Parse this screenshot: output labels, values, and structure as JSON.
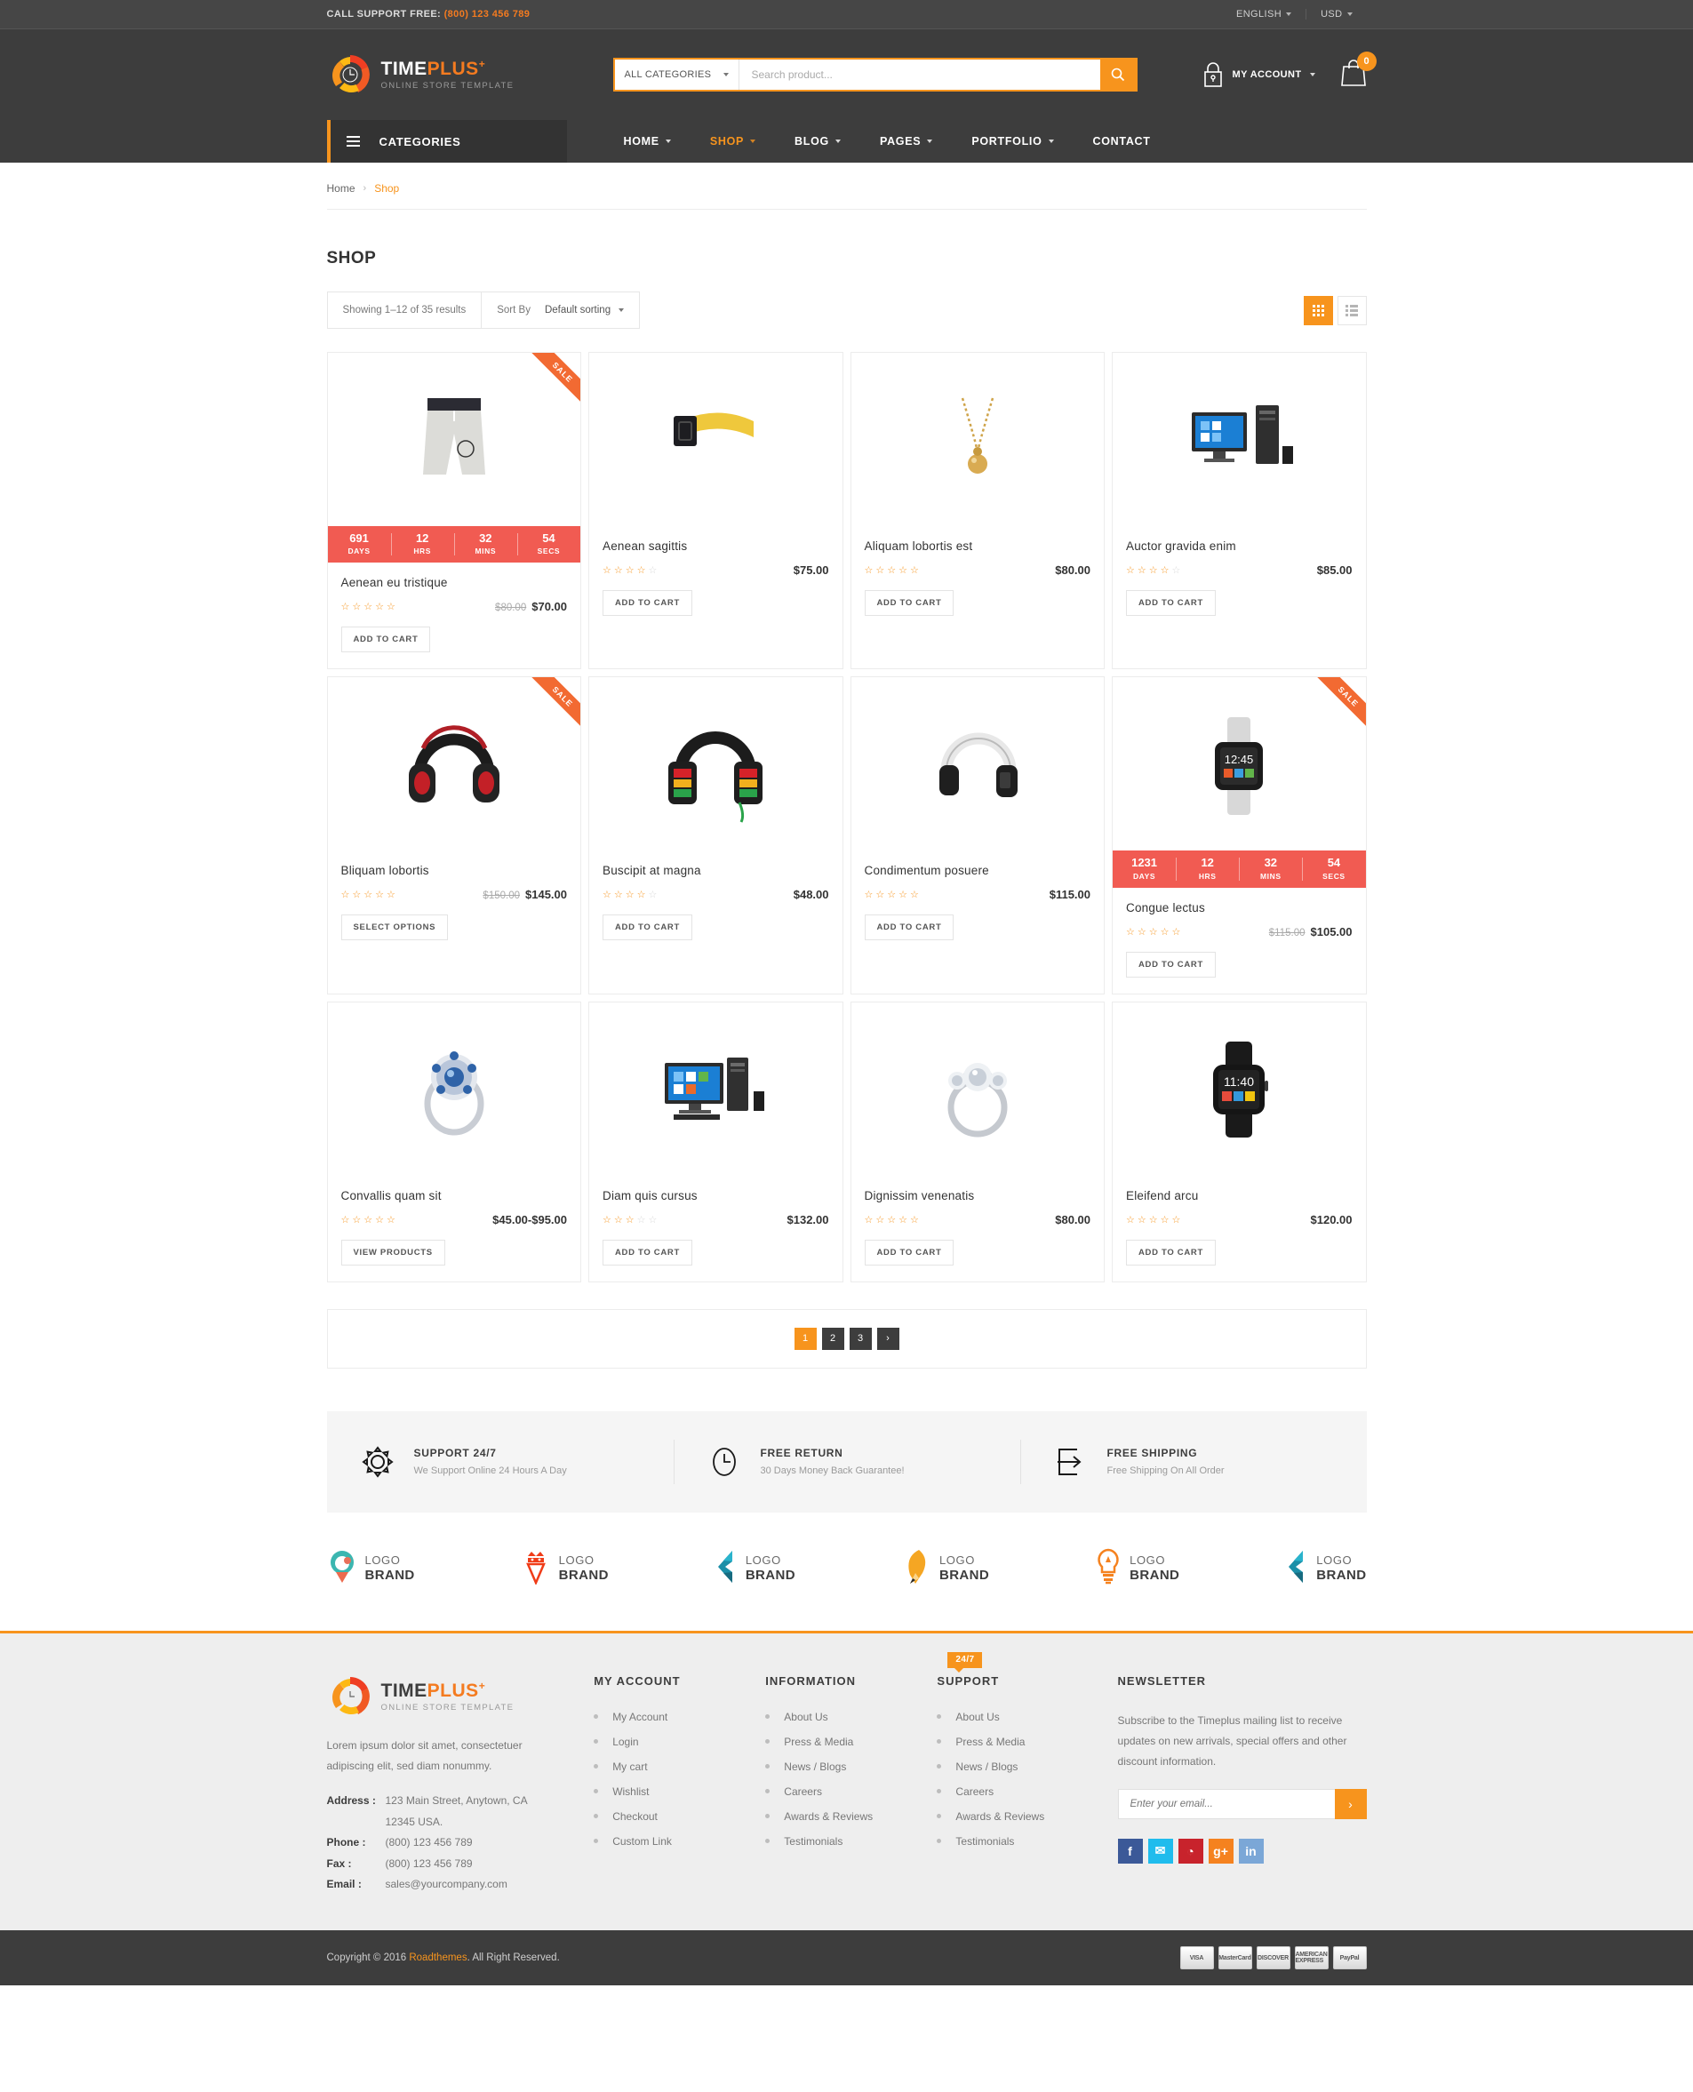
{
  "topbar": {
    "call_label": "CALL SUPPORT FREE:",
    "call_number": "(800) 123 456  789",
    "language": "ENGLISH",
    "currency": "USD"
  },
  "header": {
    "logo_name": "TIME",
    "logo_name2": "PLUS",
    "logo_sup": "+",
    "logo_tagline": "ONLINE STORE TEMPLATE",
    "category_select": "ALL CATEGORIES",
    "search_placeholder": "Search product...",
    "search_value": "",
    "search_icon": "search-icon",
    "account_label": "MY ACCOUNT",
    "account_icon": "lock-icon",
    "cart_icon": "shopping-bag-icon",
    "cart_count": "0"
  },
  "nav": {
    "categories_label": "CATEGORIES",
    "menu_icon": "hamburger-icon",
    "items": [
      {
        "label": "HOME",
        "has_caret": true,
        "active": false
      },
      {
        "label": "SHOP",
        "has_caret": true,
        "active": true
      },
      {
        "label": "BLOG",
        "has_caret": true,
        "active": false
      },
      {
        "label": "PAGES",
        "has_caret": true,
        "active": false
      },
      {
        "label": "PORTFOLIO",
        "has_caret": true,
        "active": false
      },
      {
        "label": "CONTACT",
        "has_caret": false,
        "active": false
      }
    ]
  },
  "breadcrumb": {
    "home": "Home",
    "separator": "›",
    "current": "Shop"
  },
  "page": {
    "title": "SHOP"
  },
  "toolbar": {
    "results_text": "Showing 1–12 of 35 results",
    "sort_label": "Sort By",
    "sort_value": "Default sorting",
    "grid_view_icon": "grid-view-icon",
    "list_view_icon": "list-view-icon"
  },
  "products": [
    {
      "title": "Aenean eu tristique",
      "rating": 5,
      "price": "$70.00",
      "old_price": "$80.00",
      "button": "ADD TO CART",
      "sale": true,
      "sale_label": "SALE",
      "countdown": {
        "days": "691",
        "hrs": "12",
        "mins": "32",
        "secs": "54",
        "days_label": "DAYS",
        "hrs_label": "HRS",
        "mins_label": "MINS",
        "secs_label": "SECS"
      },
      "image": "shorts"
    },
    {
      "title": "Aenean sagittis",
      "rating": 4,
      "price": "$75.00",
      "old_price": "",
      "button": "ADD TO CART",
      "sale": false,
      "image": "belt"
    },
    {
      "title": "Aliquam lobortis est",
      "rating": 5,
      "price": "$80.00",
      "old_price": "",
      "button": "ADD TO CART",
      "sale": false,
      "image": "necklace"
    },
    {
      "title": "Auctor gravida enim",
      "rating": 4,
      "price": "$85.00",
      "old_price": "",
      "button": "ADD TO CART",
      "sale": false,
      "image": "computer"
    },
    {
      "title": "Bliquam lobortis",
      "rating": 5,
      "price": "$145.00",
      "old_price": "$150.00",
      "button": "SELECT OPTIONS",
      "sale": true,
      "sale_label": "SALE",
      "image": "headphone-red"
    },
    {
      "title": "Buscipit at magna",
      "rating": 4,
      "price": "$48.00",
      "old_price": "",
      "button": "ADD TO CART",
      "sale": false,
      "image": "headphone-green"
    },
    {
      "title": "Condimentum posuere",
      "rating": 5,
      "price": "$115.00",
      "old_price": "",
      "button": "ADD TO CART",
      "sale": false,
      "image": "headphone-white"
    },
    {
      "title": "Congue lectus",
      "rating": 5,
      "price": "$105.00",
      "old_price": "$115.00",
      "button": "ADD TO CART",
      "sale": true,
      "sale_label": "SALE",
      "countdown": {
        "days": "1231",
        "hrs": "12",
        "mins": "32",
        "secs": "54",
        "days_label": "DAYS",
        "hrs_label": "HRS",
        "mins_label": "MINS",
        "secs_label": "SECS"
      },
      "image": "smartwatch"
    },
    {
      "title": "Convallis quam sit",
      "rating": 5,
      "price": "$45.00-$95.00",
      "old_price": "",
      "button": "VIEW PRODUCTS",
      "sale": false,
      "image": "ring-blue"
    },
    {
      "title": "Diam quis cursus",
      "rating": 3,
      "price": "$132.00",
      "old_price": "",
      "button": "ADD TO CART",
      "sale": false,
      "image": "desktop"
    },
    {
      "title": "Dignissim venenatis",
      "rating": 5,
      "price": "$80.00",
      "old_price": "",
      "button": "ADD TO CART",
      "sale": false,
      "image": "ring-silver"
    },
    {
      "title": "Eleifend arcu",
      "rating": 5,
      "price": "$120.00",
      "old_price": "",
      "button": "ADD TO CART",
      "sale": false,
      "image": "smartwatch-black"
    }
  ],
  "pagination": {
    "pages": [
      "1",
      "2",
      "3"
    ],
    "next": "›",
    "active": "1"
  },
  "features": [
    {
      "icon": "gear-icon",
      "title": "SUPPORT 24/7",
      "desc": "We Support Online 24 Hours A Day"
    },
    {
      "icon": "clock-icon",
      "title": "FREE RETURN",
      "desc": "30 Days Money Back Guarantee!"
    },
    {
      "icon": "shipping-arrow-icon",
      "title": "FREE SHIPPING",
      "desc": "Free Shipping On All Order"
    }
  ],
  "brands": [
    {
      "logo_icon": "teal-leaf-logo",
      "line1": "LOGO",
      "line2": "BRAND",
      "color": "#3bb6b0"
    },
    {
      "logo_icon": "red-crown-diamond-logo",
      "line1": "LOGO",
      "line2": "BRAND",
      "color": "#f03c18"
    },
    {
      "logo_icon": "teal-arrow-logo",
      "line1": "LOGO",
      "line2": "BRAND",
      "color": "#1b8fa8"
    },
    {
      "logo_icon": "orange-pencil-logo",
      "line1": "LOGO",
      "line2": "BRAND",
      "color": "#f5a623"
    },
    {
      "logo_icon": "orange-bulb-logo",
      "line1": "LOGO",
      "line2": "BRAND",
      "color": "#f5821f"
    },
    {
      "logo_icon": "teal-arrow-logo-2",
      "line1": "LOGO",
      "line2": "BRAND",
      "color": "#1b8fa8"
    }
  ],
  "footer": {
    "logo_name": "TIME",
    "logo_name2": "PLUS",
    "logo_sup": "+",
    "logo_tagline": "ONLINE STORE TEMPLATE",
    "about": "Lorem ipsum dolor sit amet, consectetuer adipiscing elit, sed diam nonummy.",
    "contact": {
      "address_key": "Address :",
      "address_v1": "123 Main Street, Anytown, CA",
      "address_v2": "12345 USA.",
      "phone_key": "Phone :",
      "phone_v": "(800) 123 456 789",
      "fax_key": "Fax :",
      "fax_v": "(800) 123 456 789",
      "email_key": "Email :",
      "email_v": "sales@yourcompany.com"
    },
    "my_account": {
      "heading": "MY ACCOUNT",
      "items": [
        "My Account",
        "Login",
        "My cart",
        "Wishlist",
        "Checkout",
        "Custom Link"
      ]
    },
    "information": {
      "heading": "INFORMATION",
      "items": [
        "About Us",
        "Press & Media",
        "News / Blogs",
        "Careers",
        "Awards & Reviews",
        "Testimonials"
      ]
    },
    "support": {
      "heading": "SUPPORT",
      "badge": "24/7",
      "items": [
        "About Us",
        "Press & Media",
        "News / Blogs",
        "Careers",
        "Awards & Reviews",
        "Testimonials"
      ]
    },
    "newsletter": {
      "heading": "NEWSLETTER",
      "text": "Subscribe to the Timeplus mailing list to receive updates on new arrivals, special offers and other discount information.",
      "placeholder": "Enter your email...",
      "value": "",
      "submit_icon": "chevron-right-icon",
      "socials": [
        {
          "name": "facebook-icon",
          "glyph": "f",
          "color": "#3b5998"
        },
        {
          "name": "twitter-icon",
          "glyph": "✉",
          "color": "#1fbced"
        },
        {
          "name": "rss-icon",
          "glyph": "◔",
          "color": "#c8232c"
        },
        {
          "name": "google-plus-icon",
          "glyph": "g+",
          "color": "#f5821f"
        },
        {
          "name": "linkedin-icon",
          "glyph": "in",
          "color": "#7ba7d7"
        }
      ]
    }
  },
  "copyright": {
    "prefix": "Copyright © 2016 ",
    "brand": "Roadthemes",
    "suffix": ". All Right Reserved.",
    "payments": [
      "VISA",
      "MasterCard",
      "DISCOVER",
      "AMERICAN EXPRESS",
      "PayPal"
    ]
  }
}
